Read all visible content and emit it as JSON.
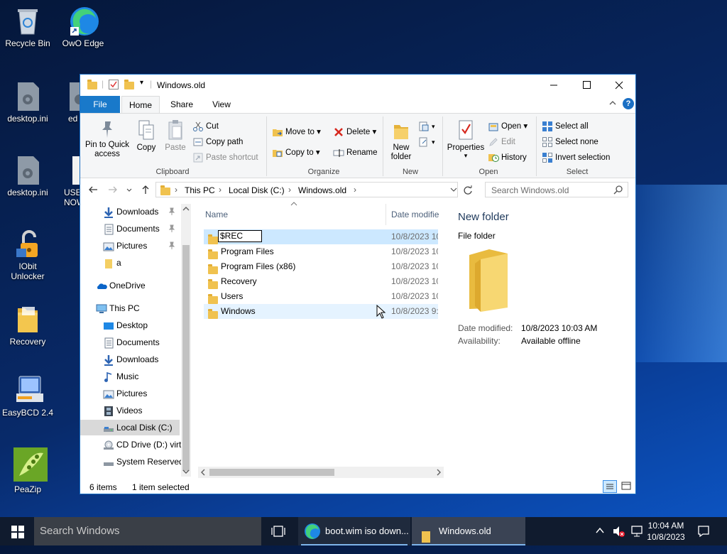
{
  "desktop": {
    "icons": [
      {
        "label": "Recycle Bin"
      },
      {
        "label": "OwO Edge"
      },
      {
        "label": "desktop.ini"
      },
      {
        "label": "ed"
      },
      {
        "label": "desktop.ini"
      },
      {
        "label": "USE NOW"
      },
      {
        "label": "IObit Unlocker"
      },
      {
        "label": "Recovery"
      },
      {
        "label": "EasyBCD 2.4"
      },
      {
        "label": "PeaZip"
      }
    ]
  },
  "window": {
    "title": "Windows.old",
    "tabs": [
      "File",
      "Home",
      "Share",
      "View"
    ],
    "ribbon": {
      "clipboard": {
        "label": "Clipboard",
        "pin": "Pin to Quick access",
        "copy": "Copy",
        "paste": "Paste",
        "cut": "Cut",
        "copy_path": "Copy path",
        "paste_shortcut": "Paste shortcut"
      },
      "organize": {
        "label": "Organize",
        "move_to": "Move to",
        "copy_to": "Copy to",
        "delete": "Delete",
        "rename": "Rename"
      },
      "new": {
        "label": "New",
        "new_folder": "New folder"
      },
      "open": {
        "label": "Open",
        "properties": "Properties",
        "open": "Open",
        "edit": "Edit",
        "history": "History"
      },
      "select": {
        "label": "Select",
        "select_all": "Select all",
        "select_none": "Select none",
        "invert": "Invert selection"
      }
    },
    "address": {
      "crumbs": [
        "This PC",
        "Local Disk (C:)",
        "Windows.old"
      ],
      "search_placeholder": "Search Windows.old"
    },
    "nav": {
      "items": [
        {
          "label": "Downloads",
          "pinned": true
        },
        {
          "label": "Documents",
          "pinned": true
        },
        {
          "label": "Pictures",
          "pinned": true
        },
        {
          "label": "a"
        },
        {
          "label": "OneDrive"
        },
        {
          "label": "This PC"
        },
        {
          "label": "Desktop"
        },
        {
          "label": "Documents"
        },
        {
          "label": "Downloads"
        },
        {
          "label": "Music"
        },
        {
          "label": "Pictures"
        },
        {
          "label": "Videos"
        },
        {
          "label": "Local Disk (C:)"
        },
        {
          "label": "CD Drive (D:) virt"
        },
        {
          "label": "System Reserved"
        }
      ]
    },
    "columns": {
      "name": "Name",
      "date": "Date modifie"
    },
    "files": [
      {
        "name": "$REC",
        "date": "10/8/2023 10:",
        "editing": true
      },
      {
        "name": "Program Files",
        "date": "10/8/2023 10:"
      },
      {
        "name": "Program Files (x86)",
        "date": "10/8/2023 10:"
      },
      {
        "name": "Recovery",
        "date": "10/8/2023 10:"
      },
      {
        "name": "Users",
        "date": "10/8/2023 10:"
      },
      {
        "name": "Windows",
        "date": "10/8/2023 9:3"
      }
    ],
    "details": {
      "name": "New folder",
      "type": "File folder",
      "date_label": "Date modified:",
      "date_value": "10/8/2023 10:03 AM",
      "avail_label": "Availability:",
      "avail_value": "Available offline"
    },
    "status": {
      "items": "6 items",
      "selected": "1 item selected"
    }
  },
  "taskbar": {
    "search_placeholder": "Search Windows",
    "apps": [
      {
        "label": "boot.wim iso down..."
      },
      {
        "label": "Windows.old"
      }
    ],
    "time": "10:04 AM",
    "date": "10/8/2023"
  },
  "colors": {
    "accent": "#1a6fc4",
    "file_tab": "#1979ca",
    "selection": "#cce8ff",
    "hover": "#e5f3ff"
  }
}
